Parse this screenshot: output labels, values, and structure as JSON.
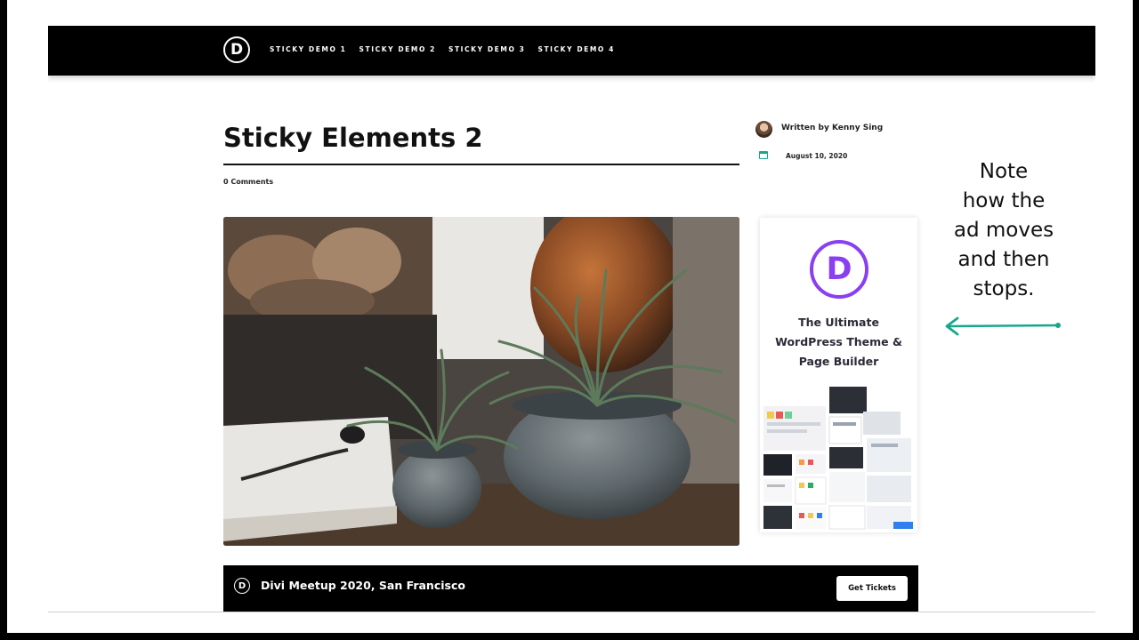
{
  "colors": {
    "nav_background": "#000000",
    "accent_teal": "#17a88a",
    "divi_purple": "#8a3ff2"
  },
  "nav": {
    "logo_letter": "D",
    "links": [
      "STICKY DEMO 1",
      "STICKY DEMO 2",
      "STICKY DEMO 3",
      "STICKY DEMO 4"
    ]
  },
  "post": {
    "title": "Sticky Elements 2",
    "comments": "0 Comments",
    "author": "Written by Kenny Sing",
    "date": "August 10, 2020",
    "image": "plants-in-pots"
  },
  "ad": {
    "logo_letter": "D",
    "lines": [
      "The Ultimate",
      "WordPress Theme &",
      "Page Builder"
    ]
  },
  "promo": {
    "icon_letter": "D",
    "text": "Divi Meetup 2020, San Francisco",
    "button": "Get Tickets"
  },
  "note": {
    "lines": [
      "Note",
      "how the",
      "ad moves",
      "and then",
      "stops."
    ],
    "arrow_icon": "arrow-left-icon"
  }
}
